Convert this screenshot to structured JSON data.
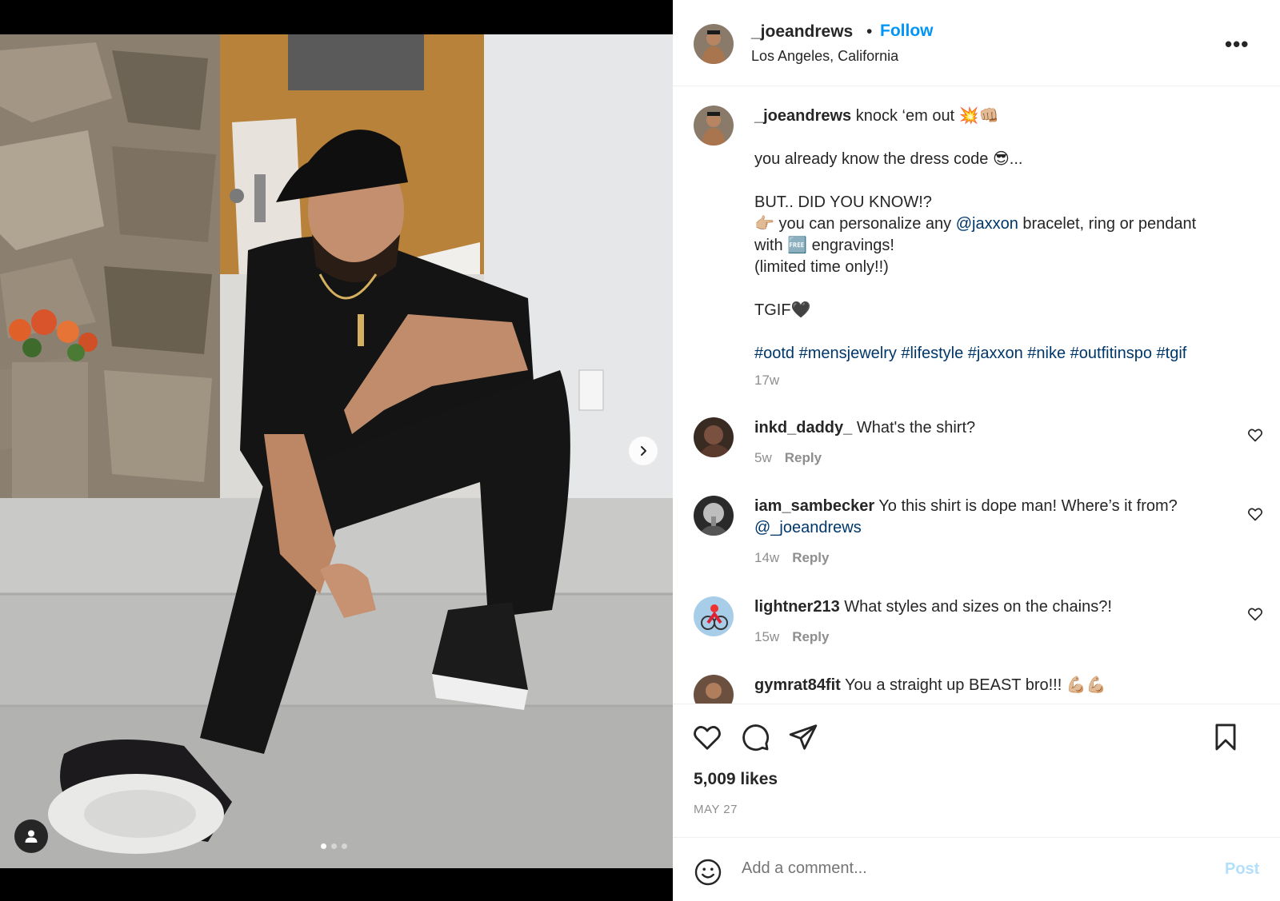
{
  "post": {
    "username": "_joeandrews",
    "separator": "•",
    "follow_label": "Follow",
    "location": "Los Angeles, California",
    "more_label": "•••",
    "likes": "5,009 likes",
    "date": "MAY 27"
  },
  "caption": {
    "username": "_joeandrews",
    "line1": " knock ‘em out 💥👊🏼",
    "line2": "you already know the dress code 😎...",
    "line3": "BUT.. DID YOU KNOW!?",
    "line4_pre": "👉🏼 you can personalize any ",
    "line4_mention": "@jaxxon",
    "line4_post": " bracelet, ring or pendant",
    "line5": "with 🆓 engravings!",
    "line6": "(limited time only!!)",
    "line7": "TGIF🖤",
    "hashtags": "#ootd #mensjewelry #lifestyle #jaxxon #nike #outfitinspo #tgif",
    "time": "17w"
  },
  "comments": [
    {
      "username": "inkd_daddy_",
      "text": " What's the shirt?",
      "time": "5w",
      "reply": "Reply"
    },
    {
      "username": "iam_sambecker",
      "text": " Yo this shirt is dope man! Where’s it from?",
      "mention": "@_joeandrews",
      "time": "14w",
      "reply": "Reply"
    },
    {
      "username": "lightner213",
      "text": " What styles and sizes on the chains?!",
      "time": "15w",
      "reply": "Reply"
    },
    {
      "username": "gymrat84fit",
      "text": " You a straight up BEAST bro!!! 💪🏼💪🏼"
    }
  ],
  "composer": {
    "placeholder": "Add a comment...",
    "post_label": "Post"
  },
  "icons": [
    "chevron-right-icon",
    "user-tag-icon",
    "heart-icon",
    "comment-icon",
    "share-icon",
    "bookmark-icon",
    "emoji-icon",
    "more-icon"
  ],
  "colors": {
    "accent": "#0095f6",
    "link": "#00376b",
    "muted": "#8e8e8e",
    "post_disabled": "#b2dffc"
  }
}
